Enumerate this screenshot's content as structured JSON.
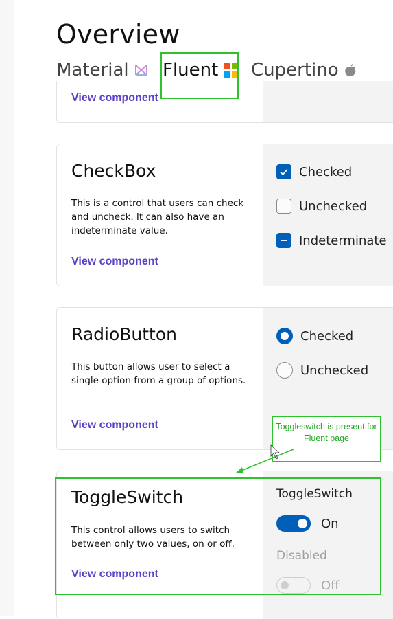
{
  "page": {
    "title": "Overview"
  },
  "tabs": [
    {
      "label": "Material",
      "icon": "material-icon",
      "selected": false
    },
    {
      "label": "Fluent",
      "icon": "windows-logo-icon",
      "selected": true
    },
    {
      "label": "Cupertino",
      "icon": "apple-icon",
      "selected": false
    }
  ],
  "cards": {
    "partial": {
      "link": "View component"
    },
    "checkbox": {
      "title": "CheckBox",
      "description": "This is a control that users can check and uncheck. It can also have an indeterminate value.",
      "link": "View component",
      "options": [
        "Checked",
        "Unchecked",
        "Indeterminate"
      ]
    },
    "radio": {
      "title": "RadioButton",
      "description": "This button allows user to select a single option from a group of options.",
      "link": "View component",
      "options": [
        "Checked",
        "Unchecked"
      ]
    },
    "toggle": {
      "title": "ToggleSwitch",
      "description": "This control allows users to switch between only two values, on or off.",
      "link": "View component",
      "header": "ToggleSwitch",
      "on_label": "On",
      "disabled_header": "Disabled",
      "off_label": "Off"
    }
  },
  "annotation": {
    "text": "Toggleswitch is present for Fluent page"
  },
  "colors": {
    "accent": "#005fb8",
    "link": "#5b3fc4",
    "tab_underline": "#5a3fbf",
    "highlight": "#2ec22e"
  }
}
